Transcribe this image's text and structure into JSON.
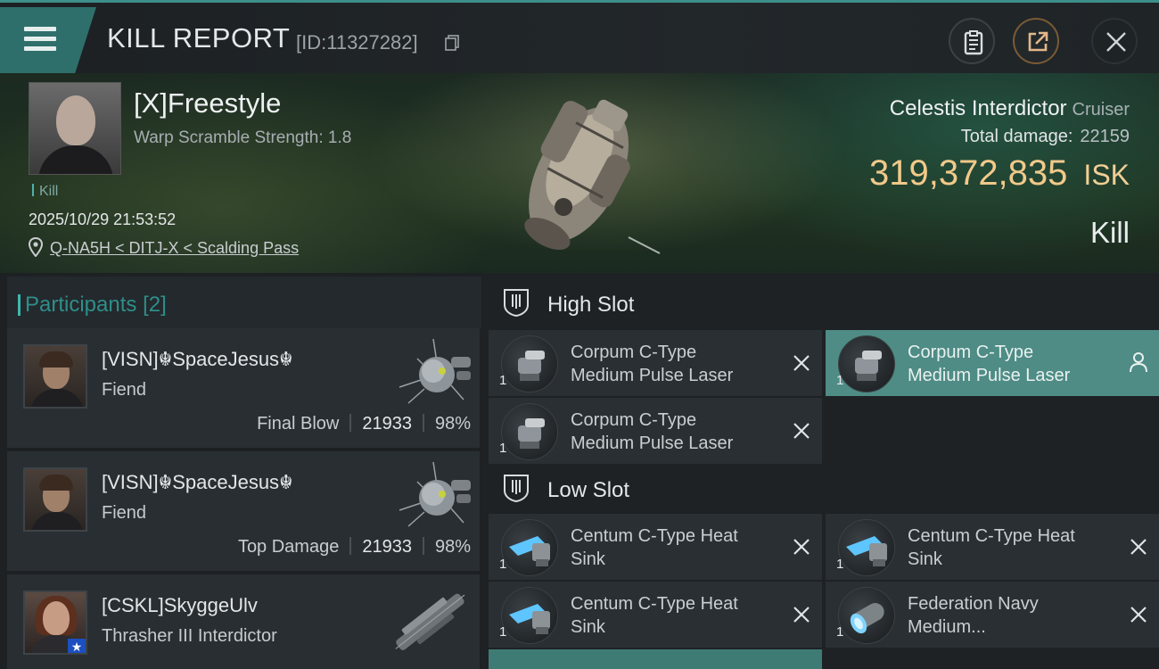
{
  "header": {
    "title": "KILL REPORT",
    "report_id": "[ID:11327282]"
  },
  "victim": {
    "name": "[X]Freestyle",
    "warp_scramble": "Warp Scramble Strength: 1.8",
    "tag": "Kill",
    "datetime": "2025/10/29 21:53:52",
    "location": "Q-NA5H < DITJ-X < Scalding Pass",
    "ship_name": "Celestis Interdictor",
    "ship_class": "Cruiser",
    "total_damage_label": "Total damage:",
    "total_damage": "22159",
    "isk_value": "319,372,835",
    "isk_unit": "ISK",
    "result": "Kill"
  },
  "participants": {
    "label": "Participants",
    "count": "[2]",
    "rows": [
      {
        "name": "[VISN]☬SpaceJesus☬",
        "ship": "Fiend",
        "role": "Final Blow",
        "damage": "21933",
        "percent": "98%"
      },
      {
        "name": "[VISN]☬SpaceJesus☬",
        "ship": "Fiend",
        "role": "Top Damage",
        "damage": "21933",
        "percent": "98%"
      },
      {
        "name": "[CSKL]SkyggeUlv",
        "ship": "Thrasher III Interdictor",
        "role": "",
        "damage": "",
        "percent": ""
      }
    ]
  },
  "fitting": {
    "high_slot_label": "High Slot",
    "low_slot_label": "Low Slot",
    "high": [
      {
        "qty": "1",
        "line1": "Corpum C-Type",
        "line2": "Medium Pulse Laser",
        "selected": false
      },
      {
        "qty": "1",
        "line1": "Corpum C-Type",
        "line2": "Medium Pulse Laser",
        "selected": true
      },
      {
        "qty": "1",
        "line1": "Corpum C-Type",
        "line2": "Medium Pulse Laser",
        "selected": false
      }
    ],
    "low": [
      {
        "qty": "1",
        "line1": "Centum C-Type Heat",
        "line2": "Sink"
      },
      {
        "qty": "1",
        "line1": "Centum C-Type Heat",
        "line2": "Sink"
      },
      {
        "qty": "1",
        "line1": "Centum C-Type Heat",
        "line2": "Sink"
      },
      {
        "qty": "1",
        "line1": "Federation Navy",
        "line2": "Medium..."
      }
    ]
  },
  "colors": {
    "accent_teal": "#3fb7ae",
    "isk_gold": "#f1c98a",
    "selected_row": "#4e8c85"
  },
  "icons": [
    "menu-icon",
    "copy-icon",
    "clipboard-icon",
    "share-icon",
    "close-icon",
    "location-pin-icon",
    "slot-icon",
    "remove-x-icon",
    "person-icon"
  ]
}
